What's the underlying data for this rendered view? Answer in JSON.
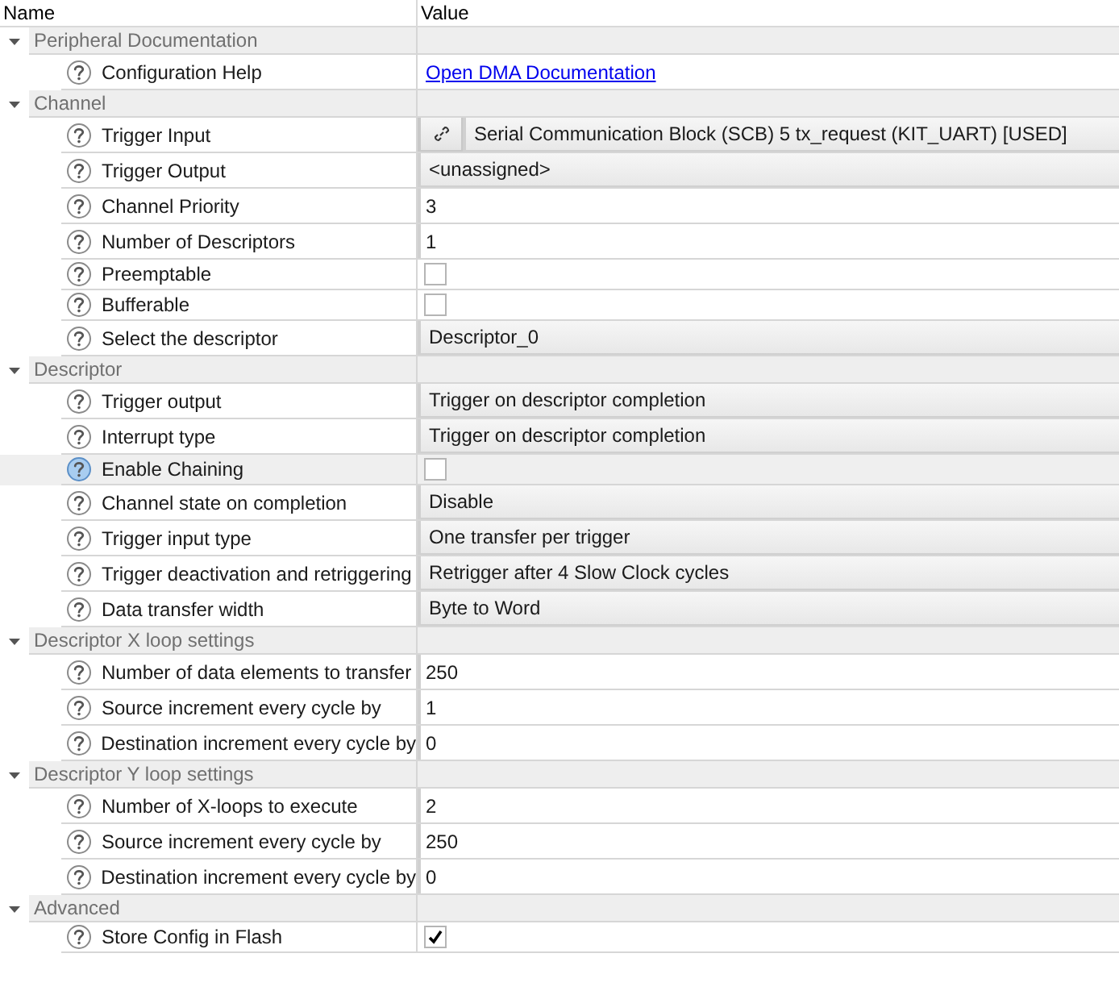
{
  "columns": [
    "Name",
    "Value"
  ],
  "sections": [
    {
      "title": "Peripheral Documentation",
      "expanded": true,
      "rows": [
        {
          "name": "Configuration Help",
          "kind": "link",
          "value": "Open DMA Documentation",
          "selected": false
        }
      ]
    },
    {
      "title": "Channel",
      "expanded": true,
      "rows": [
        {
          "name": "Trigger Input",
          "kind": "linked_dropdown",
          "value": "Serial Communication Block (SCB) 5 tx_request (KIT_UART) [USED]",
          "selected": false
        },
        {
          "name": "Trigger Output",
          "kind": "dropdown",
          "value": "<unassigned>",
          "selected": false
        },
        {
          "name": "Channel Priority",
          "kind": "text",
          "value": "3",
          "selected": false
        },
        {
          "name": "Number of Descriptors",
          "kind": "text",
          "value": "1",
          "selected": false
        },
        {
          "name": "Preemptable",
          "kind": "checkbox",
          "checked": false,
          "selected": false
        },
        {
          "name": "Bufferable",
          "kind": "checkbox",
          "checked": false,
          "selected": false
        },
        {
          "name": "Select the descriptor",
          "kind": "dropdown",
          "value": "Descriptor_0",
          "selected": false
        }
      ]
    },
    {
      "title": "Descriptor",
      "expanded": true,
      "rows": [
        {
          "name": "Trigger output",
          "kind": "dropdown",
          "value": "Trigger on descriptor completion",
          "selected": false
        },
        {
          "name": "Interrupt type",
          "kind": "dropdown",
          "value": "Trigger on descriptor completion",
          "selected": false
        },
        {
          "name": "Enable Chaining",
          "kind": "checkbox",
          "checked": false,
          "selected": true
        },
        {
          "name": "Channel state on completion",
          "kind": "dropdown",
          "value": "Disable",
          "selected": false
        },
        {
          "name": "Trigger input type",
          "kind": "dropdown",
          "value": "One transfer per trigger",
          "selected": false
        },
        {
          "name": "Trigger deactivation and retriggering",
          "kind": "dropdown",
          "value": "Retrigger after 4 Slow Clock cycles",
          "selected": false
        },
        {
          "name": "Data transfer width",
          "kind": "dropdown",
          "value": "Byte to Word",
          "selected": false
        }
      ]
    },
    {
      "title": "Descriptor X loop settings",
      "expanded": true,
      "rows": [
        {
          "name": "Number of data elements to transfer",
          "kind": "text",
          "value": "250",
          "selected": false
        },
        {
          "name": "Source increment every cycle by",
          "kind": "text",
          "value": "1",
          "selected": false
        },
        {
          "name": "Destination increment every cycle by",
          "kind": "text",
          "value": "0",
          "selected": false
        }
      ]
    },
    {
      "title": "Descriptor Y loop settings",
      "expanded": true,
      "rows": [
        {
          "name": "Number of X-loops to execute",
          "kind": "text",
          "value": "2",
          "selected": false
        },
        {
          "name": "Source increment every cycle by",
          "kind": "text",
          "value": "250",
          "selected": false
        },
        {
          "name": "Destination increment every cycle by",
          "kind": "text",
          "value": "0",
          "selected": false
        }
      ]
    },
    {
      "title": "Advanced",
      "expanded": true,
      "rows": [
        {
          "name": "Store Config in Flash",
          "kind": "checkbox",
          "checked": true,
          "selected": false
        }
      ]
    }
  ]
}
